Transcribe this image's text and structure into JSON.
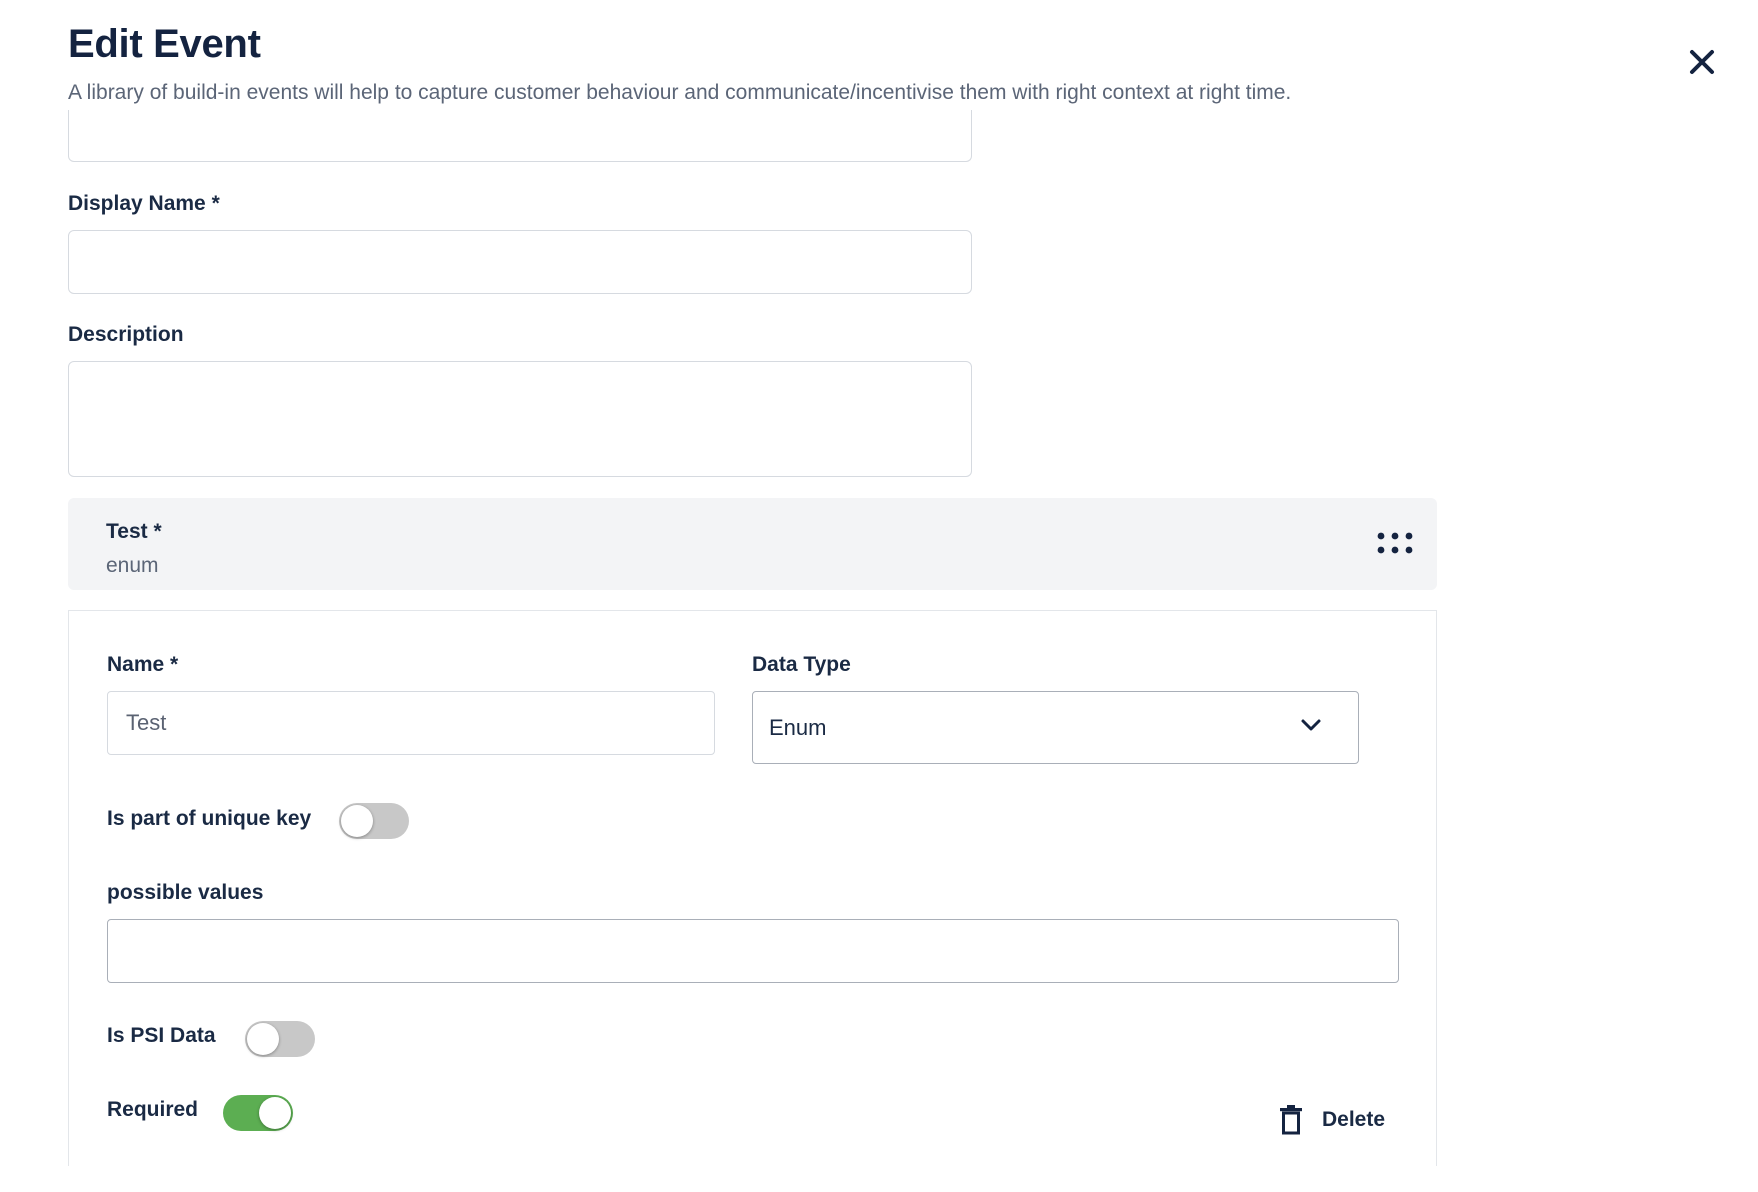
{
  "header": {
    "title": "Edit Event",
    "subtitle": "A library of build-in events will help to capture customer behaviour and communicate/incentivise them with right context at right time."
  },
  "form": {
    "display_name_label": "Display Name *",
    "display_name_value": "",
    "description_label": "Description",
    "description_value": ""
  },
  "attribute": {
    "title": "Test *",
    "type": "enum",
    "name_label": "Name *",
    "name_value": "Test",
    "data_type_label": "Data Type",
    "data_type_value": "Enum",
    "unique_key_label": "Is part of unique key",
    "unique_key_on": false,
    "possible_values_label": "possible values",
    "possible_values_value": "",
    "psi_label": "Is PSI Data",
    "psi_on": false,
    "required_label": "Required",
    "required_on": true,
    "delete_label": "Delete"
  },
  "colors": {
    "toggle_on": "#5cae52",
    "toggle_off": "#c8c8c8",
    "title": "#142340"
  },
  "icons": [
    "close-icon",
    "more-dots-icon",
    "chevron-down-icon",
    "trash-icon"
  ]
}
